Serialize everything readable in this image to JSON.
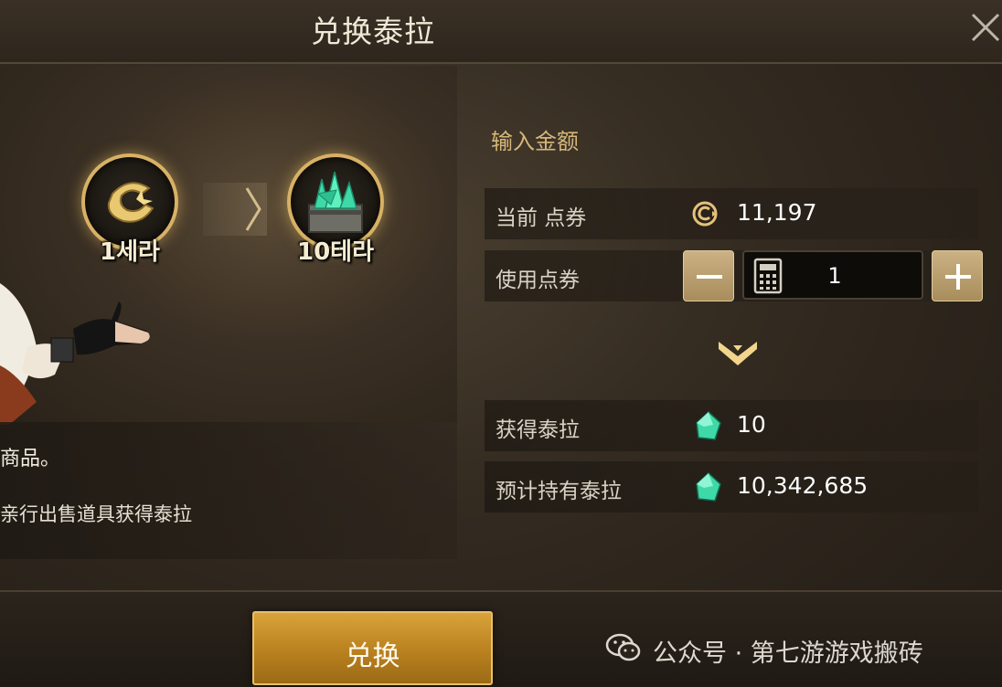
{
  "header": {
    "title": "兑换泰拉"
  },
  "conversion": {
    "from_label": "1세라",
    "to_label": "10테라"
  },
  "info": {
    "line1": "商品。",
    "line2": "亲行出售道具获得泰拉"
  },
  "form": {
    "section_title": "输入金额",
    "current_points": {
      "label": "当前 点券",
      "value": "11,197"
    },
    "use_points": {
      "label": "使用点券",
      "value": "1",
      "decrement": "−",
      "increment": "+"
    },
    "obtain_tera": {
      "label": "获得泰拉",
      "value": "10"
    },
    "expected_tera": {
      "label": "预计持有泰拉",
      "value": "10,342,685"
    }
  },
  "footer": {
    "exchange_label": "兑换",
    "watermark": "公众号 · 第七游游戏搬砖"
  },
  "colors": {
    "accent_gold": "#d7b165",
    "button_gold": "#c9922c",
    "title_gold": "#d6b779",
    "gem_green": "#3fd9a8"
  },
  "icons": {
    "close": "close-icon",
    "coin": "gold-coin-icon",
    "gem": "green-gem-icon",
    "calculator": "calculator-icon",
    "chevron": "chevron-down-icon"
  }
}
